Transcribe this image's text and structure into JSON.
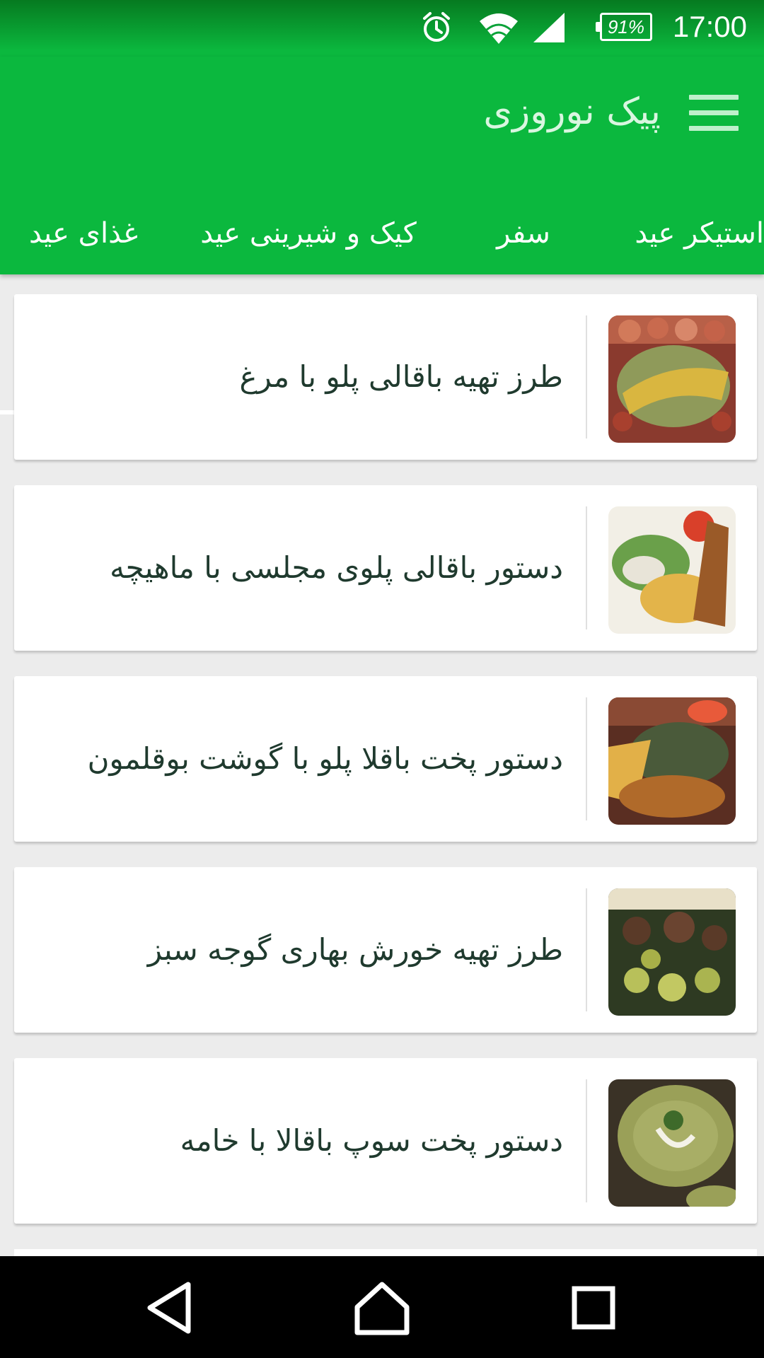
{
  "status_bar": {
    "time": "17:00",
    "battery_percent": "91%",
    "icons": [
      "alarm-icon",
      "wifi-icon",
      "cellular-signal-icon",
      "battery-icon"
    ]
  },
  "app_bar": {
    "title": "پیک نوروزی",
    "menu_icon": "hamburger-menu-icon"
  },
  "tabs": [
    {
      "label": "غذای عید",
      "selected": true
    },
    {
      "label": "کیک و شیرینی عید",
      "selected": false
    },
    {
      "label": "سفر",
      "selected": false
    },
    {
      "label": "استیکر عید",
      "selected": false
    }
  ],
  "list_items": [
    {
      "title": "طرز تهیه باقالی پلو با مرغ",
      "thumbnail": "baghali-polo-chicken-photo"
    },
    {
      "title": "دستور باقالی پلوی مجلسی با ماهیچه",
      "thumbnail": "baghali-polo-shank-photo"
    },
    {
      "title": "دستور پخت باقلا پلو با گوشت بوقلمون",
      "thumbnail": "baghala-polo-turkey-photo"
    },
    {
      "title": "طرز تهیه خورش بهاری گوجه سبز",
      "thumbnail": "green-plum-stew-photo"
    },
    {
      "title": "دستور پخت سوپ باقالا با خامه",
      "thumbnail": "fava-bean-cream-soup-photo"
    }
  ],
  "nav_bar": {
    "buttons": [
      "back-icon",
      "home-icon",
      "recents-icon"
    ]
  },
  "colors": {
    "primary": "#0bb83e",
    "status_bar_dark": "#067a20",
    "background": "#ececec",
    "card": "#ffffff",
    "title_text": "#1f3a2e"
  }
}
